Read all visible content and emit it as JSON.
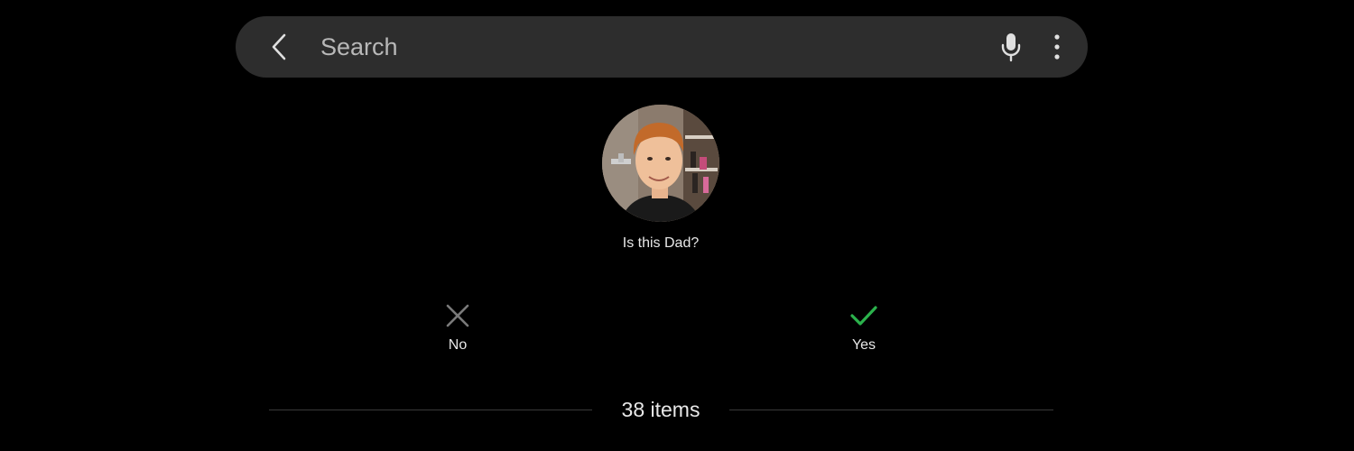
{
  "search": {
    "placeholder": "Search"
  },
  "prompt": {
    "question": "Is this Dad?"
  },
  "choices": {
    "no_label": "No",
    "yes_label": "Yes"
  },
  "footer": {
    "items_count": "38 items"
  },
  "colors": {
    "background": "#000000",
    "search_bar": "#2d2d2d",
    "yes_accent": "#2bb24c",
    "no_icon": "#7a7a7a",
    "text": "#e8e8e8"
  },
  "icons": {
    "back": "chevron-left-icon",
    "mic": "microphone-icon",
    "more": "more-vertical-icon",
    "no": "close-icon",
    "yes": "check-icon"
  }
}
